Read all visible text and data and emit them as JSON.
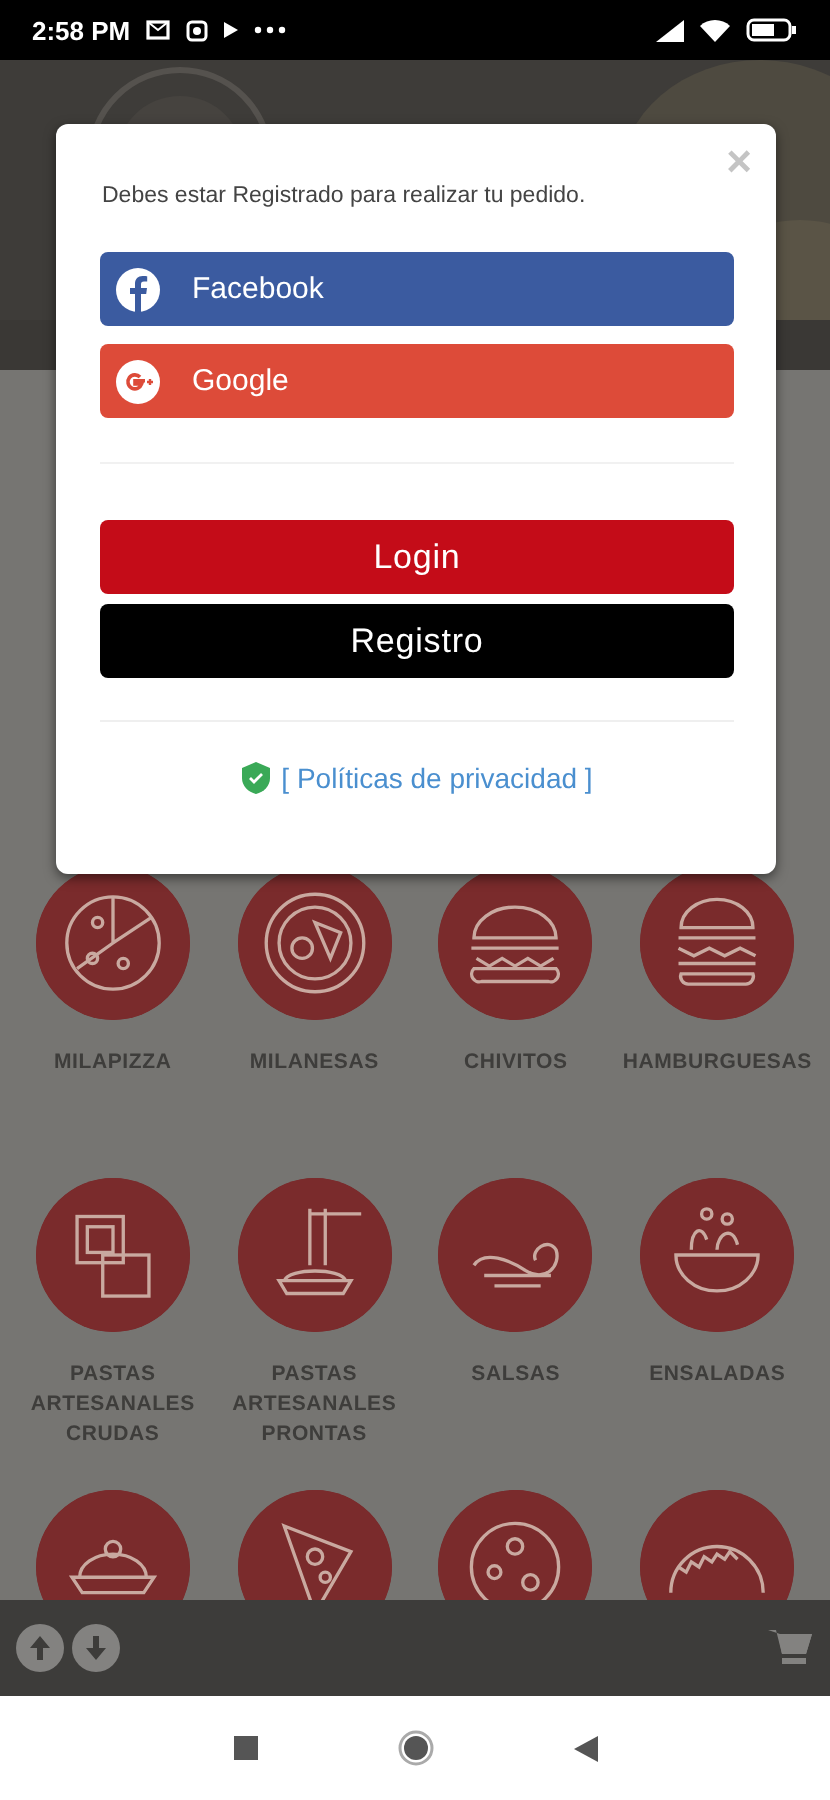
{
  "status_bar": {
    "time": "2:58 PM"
  },
  "dialog": {
    "close": "×",
    "message": "Debes estar Registrado para realizar tu pedido.",
    "social_buttons": [
      {
        "kind": "facebook",
        "label": "Facebook"
      },
      {
        "kind": "google",
        "label": "Google"
      }
    ],
    "buttons": [
      {
        "kind": "login",
        "label": "Login"
      },
      {
        "kind": "register",
        "label": "Registro"
      }
    ],
    "privacy_link": "[ Políticas de privacidad ]"
  },
  "categories": [
    {
      "label": "MILAPIZZA"
    },
    {
      "label": "MILANESAS"
    },
    {
      "label": "CHIVITOS"
    },
    {
      "label": "HAMBURGUESAS"
    },
    {
      "label": "PASTAS ARTESANALES CRUDAS"
    },
    {
      "label": "PASTAS ARTESANALES PRONTAS"
    },
    {
      "label": "SALSAS"
    },
    {
      "label": "ENSALADAS"
    }
  ]
}
